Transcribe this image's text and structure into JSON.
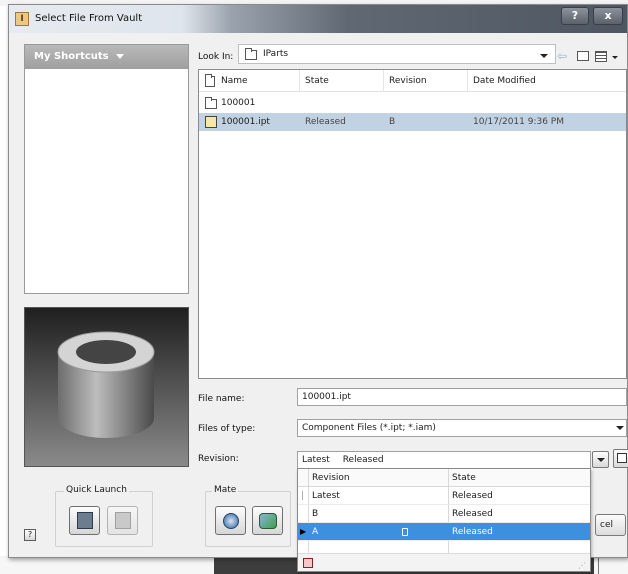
{
  "window": {
    "title": "Select File From Vault",
    "help_label": "?",
    "close_label": "x"
  },
  "shortcuts": {
    "header": "My Shortcuts"
  },
  "look_in": {
    "label": "Look In:",
    "value": "IParts"
  },
  "file_list": {
    "columns": [
      "Name",
      "State",
      "Revision",
      "Date Modified"
    ],
    "rows": [
      {
        "name": "100001",
        "state": "",
        "revision": "",
        "date": "",
        "icon": "folder-icon",
        "selected": false
      },
      {
        "name": "100001.ipt",
        "state": "Released",
        "revision": "B",
        "date": "10/17/2011 9:36 PM",
        "icon": "part-file-icon",
        "selected": true
      }
    ]
  },
  "fields": {
    "file_name_label": "File name:",
    "file_name_value": "100001.ipt",
    "files_of_type_label": "Files of type:",
    "files_of_type_value": "Component Files (*.ipt; *.iam)",
    "revision_label": "Revision:",
    "revision_value_rev": "Latest",
    "revision_value_state": "Released"
  },
  "revision_dropdown": {
    "columns": [
      "Revision",
      "State"
    ],
    "rows": [
      {
        "revision": "Latest",
        "state": "Released",
        "selected": false
      },
      {
        "revision": "B",
        "state": "Released",
        "selected": false
      },
      {
        "revision": "A",
        "state": "Released",
        "selected": true
      }
    ]
  },
  "quick_launch": {
    "label": "Quick Launch"
  },
  "mate": {
    "label": "Mate"
  },
  "buttons": {
    "cancel_label": "cel"
  },
  "colors": {
    "selection_row": "#c1d3e3",
    "dropdown_selection": "#3d8fe0",
    "shortcuts_header": "#a9a9a9"
  }
}
